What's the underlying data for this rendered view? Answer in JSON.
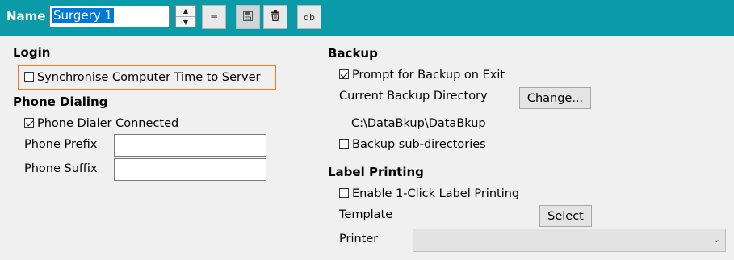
{
  "header": {
    "name_label": "Name",
    "name_value": "Surgery 1",
    "spinner_up": "▲",
    "spinner_down": "▼",
    "align_icon": "≡",
    "save_icon": "💾",
    "delete_icon": "🗑",
    "db_label": "db"
  },
  "login": {
    "heading": "Login",
    "sync_time_label": "Synchronise Computer Time to Server",
    "sync_time_checked": false
  },
  "phone": {
    "heading": "Phone Dialing",
    "dialer_label": "Phone Dialer Connected",
    "dialer_checked": true,
    "prefix_label": "Phone Prefix",
    "prefix_value": "",
    "suffix_label": "Phone Suffix",
    "suffix_value": ""
  },
  "backup": {
    "heading": "Backup",
    "prompt_label": "Prompt for Backup on Exit",
    "prompt_checked": true,
    "dir_label": "Current Backup Directory",
    "change_button": "Change...",
    "dir_value": "C:\\DataBkup\\DataBkup",
    "subdirs_label": "Backup sub-directories",
    "subdirs_checked": false
  },
  "label_printing": {
    "heading": "Label Printing",
    "enable_label": "Enable 1-Click Label Printing",
    "enable_checked": false,
    "template_label": "Template",
    "select_button": "Select",
    "printer_label": "Printer",
    "printer_value": "",
    "chevron": "⌄"
  },
  "colors": {
    "header_bg": "#0b9aa8",
    "focus_border": "#ef7d28",
    "selection": "#0078d7"
  }
}
